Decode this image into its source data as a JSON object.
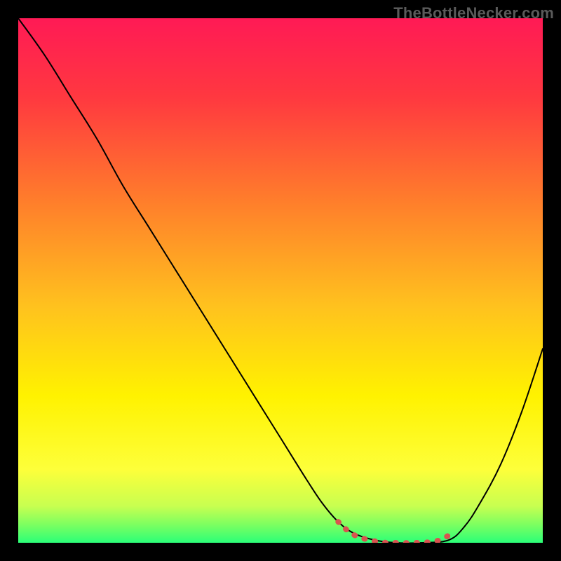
{
  "watermark": "TheBottleNecker.com",
  "chart_data": {
    "type": "line",
    "title": "",
    "xlabel": "",
    "ylabel": "",
    "xlim": [
      0,
      1
    ],
    "ylim": [
      0,
      1
    ],
    "background_gradient": {
      "stops": [
        {
          "offset": 0.0,
          "color": "#ff1a55"
        },
        {
          "offset": 0.15,
          "color": "#ff3840"
        },
        {
          "offset": 0.35,
          "color": "#ff7e2b"
        },
        {
          "offset": 0.55,
          "color": "#ffc21e"
        },
        {
          "offset": 0.72,
          "color": "#fff200"
        },
        {
          "offset": 0.86,
          "color": "#fdff3a"
        },
        {
          "offset": 0.93,
          "color": "#c8ff50"
        },
        {
          "offset": 0.965,
          "color": "#7dff60"
        },
        {
          "offset": 1.0,
          "color": "#2bff78"
        }
      ]
    },
    "series": [
      {
        "name": "bottleneck-curve",
        "stroke": "#000000",
        "stroke_width": 2,
        "x": [
          0.0,
          0.05,
          0.1,
          0.15,
          0.2,
          0.25,
          0.3,
          0.35,
          0.4,
          0.45,
          0.5,
          0.55,
          0.58,
          0.61,
          0.64,
          0.68,
          0.72,
          0.77,
          0.82,
          0.85,
          0.88,
          0.92,
          0.96,
          1.0
        ],
        "y": [
          1.0,
          0.93,
          0.85,
          0.77,
          0.68,
          0.6,
          0.52,
          0.44,
          0.36,
          0.28,
          0.2,
          0.12,
          0.075,
          0.04,
          0.018,
          0.005,
          0.0,
          0.0,
          0.005,
          0.03,
          0.075,
          0.15,
          0.25,
          0.37
        ]
      },
      {
        "name": "sweet-spot",
        "stroke": "#d9534f",
        "stroke_width": 8,
        "linecap": "round",
        "x": [
          0.61,
          0.64,
          0.685,
          0.72,
          0.76,
          0.8,
          0.83
        ],
        "y": [
          0.04,
          0.015,
          0.002,
          0.0,
          0.0,
          0.004,
          0.02
        ]
      }
    ]
  }
}
